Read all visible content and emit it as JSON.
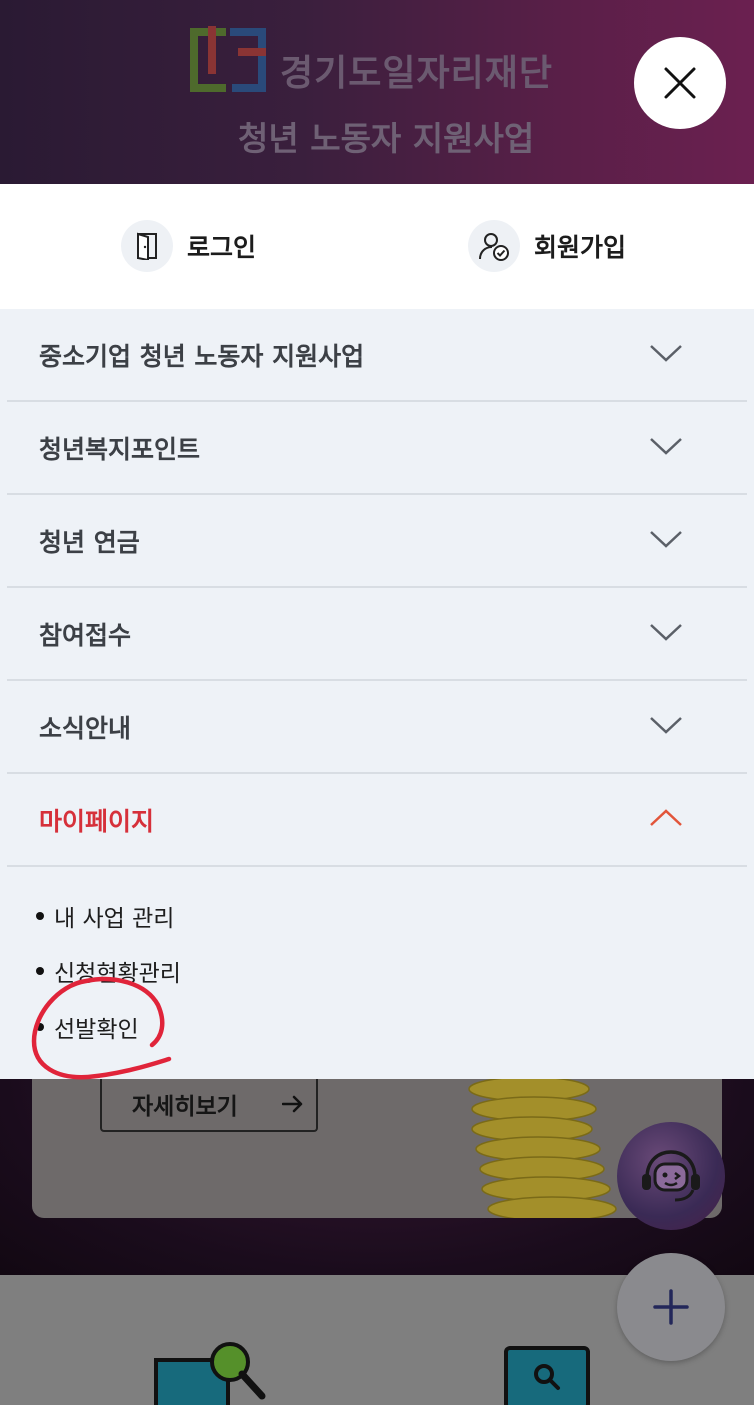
{
  "header": {
    "org_name": "경기도일자리재단",
    "program_name": "청년 노동자 지원사업"
  },
  "auth": {
    "login_label": "로그인",
    "signup_label": "회원가입"
  },
  "menu": {
    "items": [
      {
        "label": "중소기업 청년 노동자 지원사업",
        "expanded": false
      },
      {
        "label": "청년복지포인트",
        "expanded": false
      },
      {
        "label": "청년 연금",
        "expanded": false
      },
      {
        "label": "참여접수",
        "expanded": false
      },
      {
        "label": "소식안내",
        "expanded": false
      },
      {
        "label": "마이페이지",
        "expanded": true
      }
    ],
    "submenu": [
      {
        "label": "내 사업 관리"
      },
      {
        "label": "신청현황관리"
      },
      {
        "label": "선발확인"
      }
    ]
  },
  "background_page": {
    "more_button_label": "자세히보기"
  },
  "colors": {
    "active": "#d6303a",
    "menu_bg": "#eef2f7",
    "annotation": "#e0243a"
  }
}
